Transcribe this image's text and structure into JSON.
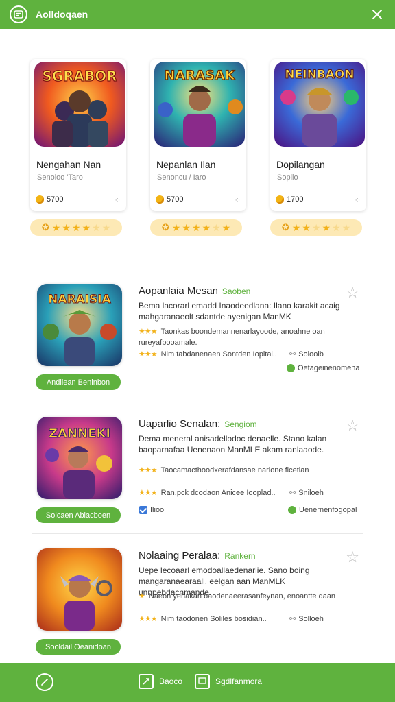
{
  "header": {
    "title": "Aolldoqaen",
    "logo_icon": "app-logo-icon",
    "close_icon": "close-icon"
  },
  "featured": [
    {
      "title_art": "SGRABOR",
      "name": "Nengahan Nan",
      "sub": "Senoloo 'Taro",
      "coins": "5700",
      "rating": 4.5
    },
    {
      "title_art": "NARASAK",
      "name": "Nepanlan Ilan",
      "sub": "Senoncu / Iaro",
      "coins": "5700",
      "rating": 4.5
    },
    {
      "title_art": "NEINBAON",
      "name": "Dopilangan",
      "sub": "Sopilo",
      "coins": "1700",
      "rating": 3.5
    }
  ],
  "items": [
    {
      "title_art": "NARAISIA",
      "title": "Aopanlaia Mesan",
      "tag": "Saoben",
      "desc": "Bema lacorarl emadd Inaodeedlana: Ilano karakit acaig mahgaranaeolt sdantde ayenigan ManMK",
      "meta1": "Taonkas boondemannenarlayoode, anoahne oan rureyafbooamale.",
      "meta2": "Nim tabdanenaen Sontden Iopital..",
      "side1": "Soloolb",
      "side2": "Oetageinenomeha",
      "button": "Andilean Beninbon"
    },
    {
      "title_art": "ZANNEKI",
      "title": "Uaparlio Senalan:",
      "tag": "Sengiom",
      "desc": "Dema meneral anisadellodoc denaelle. Stano kalan baoparnafaa Uenenaon ManMLE akam ranlaaode.",
      "meta1": "Taocamacthoodxerafdansae narione ficetian",
      "meta2": "Ran.pck dcodaon Anicee Iooplad..",
      "side1": "Sniloeh",
      "check": "Ilioo",
      "side2": "Uenernenfogopal",
      "button": "Solcaen Ablacboen"
    },
    {
      "title_art": "",
      "title": "Nolaaing Peralaa:",
      "tag": "Rankern",
      "desc": "Uepe lecoaarl emodoallaedenarlie. Sano boing mangaranaearaall, eelgan aan ManMLK unnpebdacnmande.",
      "meta1": "Naeon yehakan baodenaeerasanfeynan, enoantte daan",
      "meta2": "Nim taodonen Soliles bosidian..",
      "side1": "Solloeh",
      "button": "Sooldail Oeanidoan"
    }
  ],
  "bottom": {
    "left_icon": "compass-icon",
    "action1": "Baoco",
    "action2": "Sgdlfanmora"
  }
}
